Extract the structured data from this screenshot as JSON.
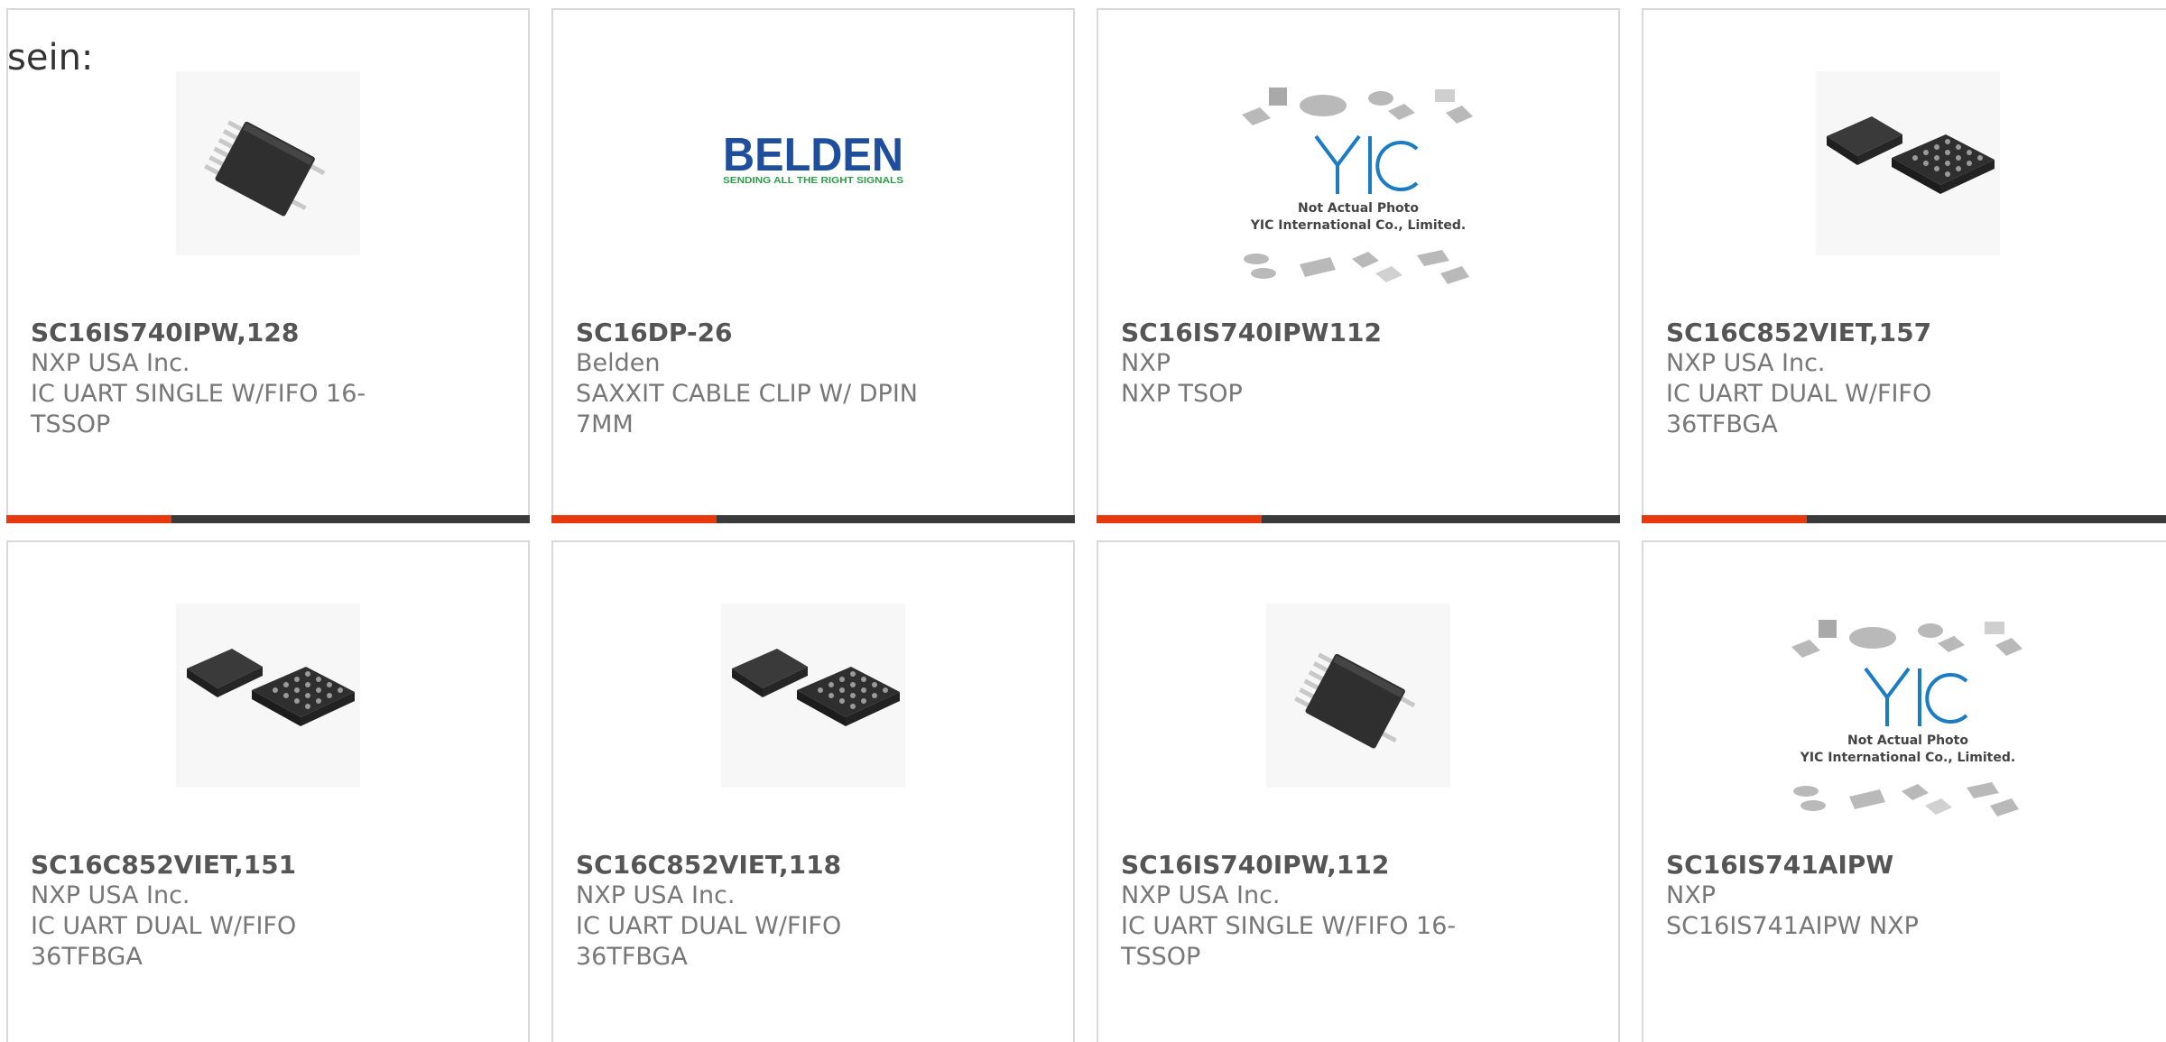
{
  "intro_text": "sein:",
  "colors": {
    "accent_red": "#e8380d",
    "accent_dark": "#3a3a3a",
    "card_border": "#d9d9d9"
  },
  "products": [
    {
      "part_number": "SC16IS740IPW,128",
      "manufacturer": "NXP USA Inc.",
      "description_line1": "IC UART SINGLE W/FIFO 16-",
      "description_line2": "TSSOP",
      "image": "chip-tssop-image"
    },
    {
      "part_number": "SC16DP-26",
      "manufacturer": "Belden",
      "description_line1": "SAXXIT CABLE CLIP W/ DPIN",
      "description_line2": "7MM",
      "image": "belden-logo-image",
      "logo_text": "BELDEN",
      "logo_tagline": "SENDING ALL THE RIGHT SIGNALS"
    },
    {
      "part_number": "SC16IS740IPW112",
      "manufacturer": "NXP",
      "description_line1": "NXP TSOP",
      "description_line2": "",
      "image": "not-actual-photo-image",
      "placeholder_line1": "Not Actual Photo",
      "placeholder_line2": "YIC International Co., Limited."
    },
    {
      "part_number": "SC16C852VIET,157",
      "manufacturer": "NXP USA Inc.",
      "description_line1": "IC UART DUAL W/FIFO 36TFBGA",
      "description_line2": "",
      "image": "chip-tfbga-image"
    },
    {
      "part_number": "SC16C852VIET,151",
      "manufacturer": "NXP USA Inc.",
      "description_line1": "IC UART DUAL W/FIFO 36TFBGA",
      "description_line2": "",
      "image": "chip-tfbga-image"
    },
    {
      "part_number": "SC16C852VIET,118",
      "manufacturer": "NXP USA Inc.",
      "description_line1": "IC UART DUAL W/FIFO 36TFBGA",
      "description_line2": "",
      "image": "chip-tfbga-image"
    },
    {
      "part_number": "SC16IS740IPW,112",
      "manufacturer": "NXP USA Inc.",
      "description_line1": "IC UART SINGLE W/FIFO 16-",
      "description_line2": "TSSOP",
      "image": "chip-tssop-image"
    },
    {
      "part_number": "SC16IS741AIPW",
      "manufacturer": "NXP",
      "description_line1": "SC16IS741AIPW NXP",
      "description_line2": "",
      "image": "not-actual-photo-image",
      "placeholder_line1": "Not Actual Photo",
      "placeholder_line2": "YIC International Co., Limited."
    }
  ]
}
